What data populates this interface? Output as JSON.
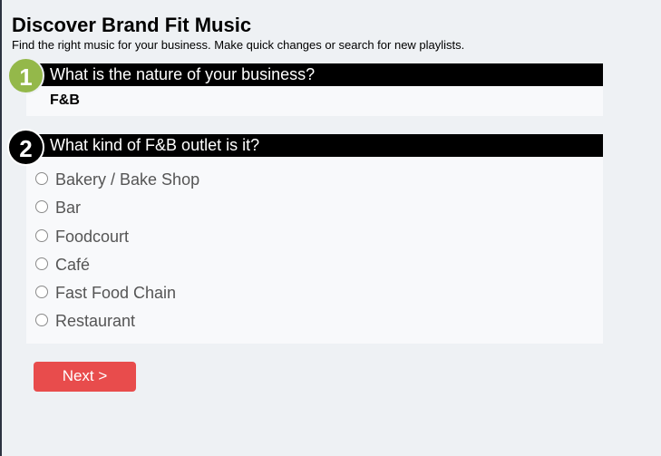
{
  "header": {
    "title": "Discover Brand Fit Music",
    "subtitle": "Find the right music for your business. Make quick changes or search for new playlists."
  },
  "questions": [
    {
      "number": "1",
      "text": "What is the nature of your business?",
      "answer": "F&B"
    },
    {
      "number": "2",
      "text": "What kind of F&B outlet is it?",
      "options": [
        "Bakery / Bake Shop",
        "Bar",
        "Foodcourt",
        "Café",
        "Fast Food Chain",
        "Restaurant"
      ]
    }
  ],
  "next_button": {
    "label": "Next >"
  },
  "colors": {
    "badge_1": "#94b84a",
    "badge_2": "#000000",
    "next_button": "#e84c4c",
    "page_background": "#eef1f4"
  }
}
